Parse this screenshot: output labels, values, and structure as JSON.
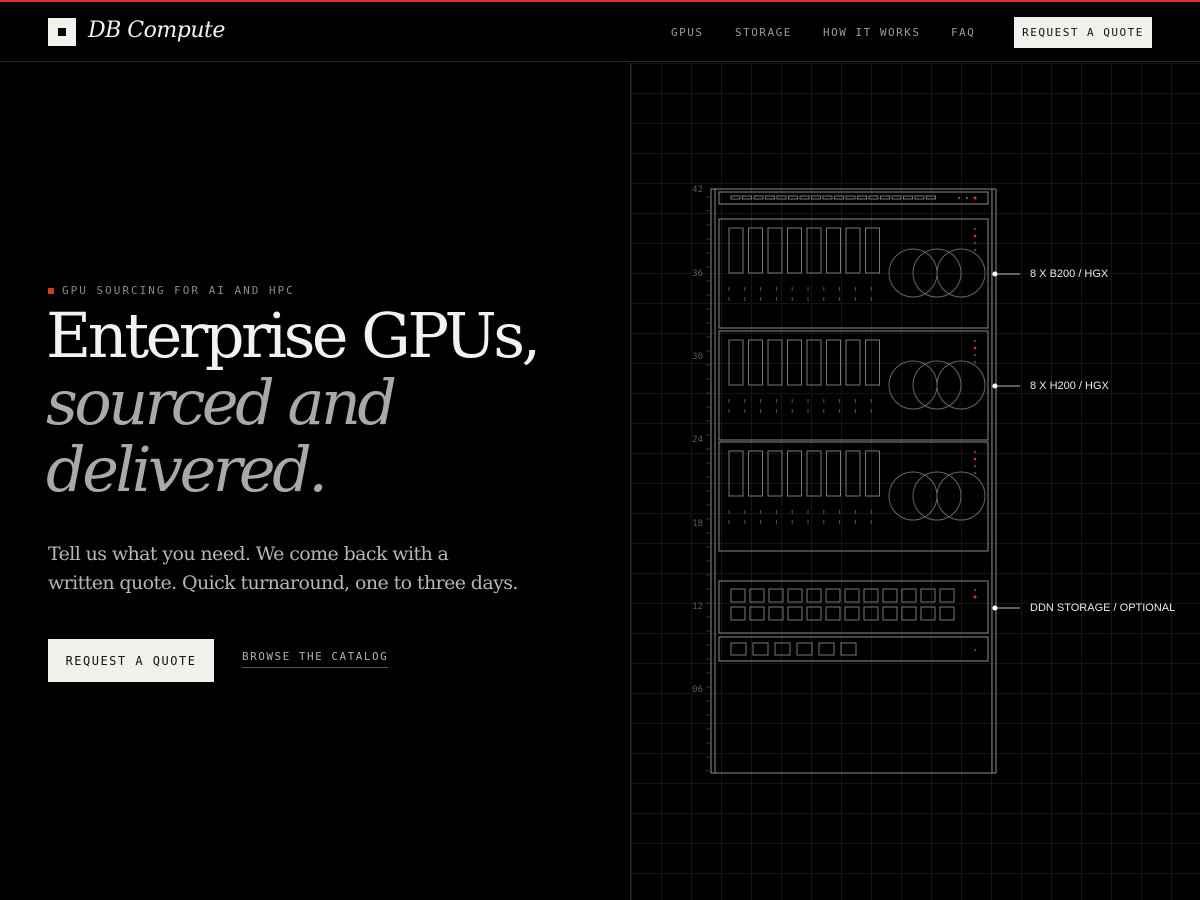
{
  "brand": {
    "name": "DB Compute",
    "accent": "#d6362f"
  },
  "nav": {
    "items": [
      "GPUS",
      "STORAGE",
      "HOW IT WORKS",
      "FAQ"
    ],
    "cta": "REQUEST A QUOTE"
  },
  "hero": {
    "eyebrow": "GPU SOURCING FOR AI AND HPC",
    "title_line1": "Enterprise GPUs,",
    "title_line2": "sourced and",
    "title_line3": "delivered.",
    "subtitle": "Tell us what you need. We come back with a written quote. Quick turnaround, one to three days.",
    "cta_primary": "REQUEST A QUOTE",
    "cta_secondary": "BROWSE THE CATALOG"
  },
  "rack": {
    "unit_labels": [
      "42",
      "36",
      "30",
      "24",
      "18",
      "12",
      "06"
    ],
    "callouts": [
      "8 X B200 / HGX",
      "8 X H200 / HGX",
      "DDN STORAGE / OPTIONAL"
    ]
  }
}
